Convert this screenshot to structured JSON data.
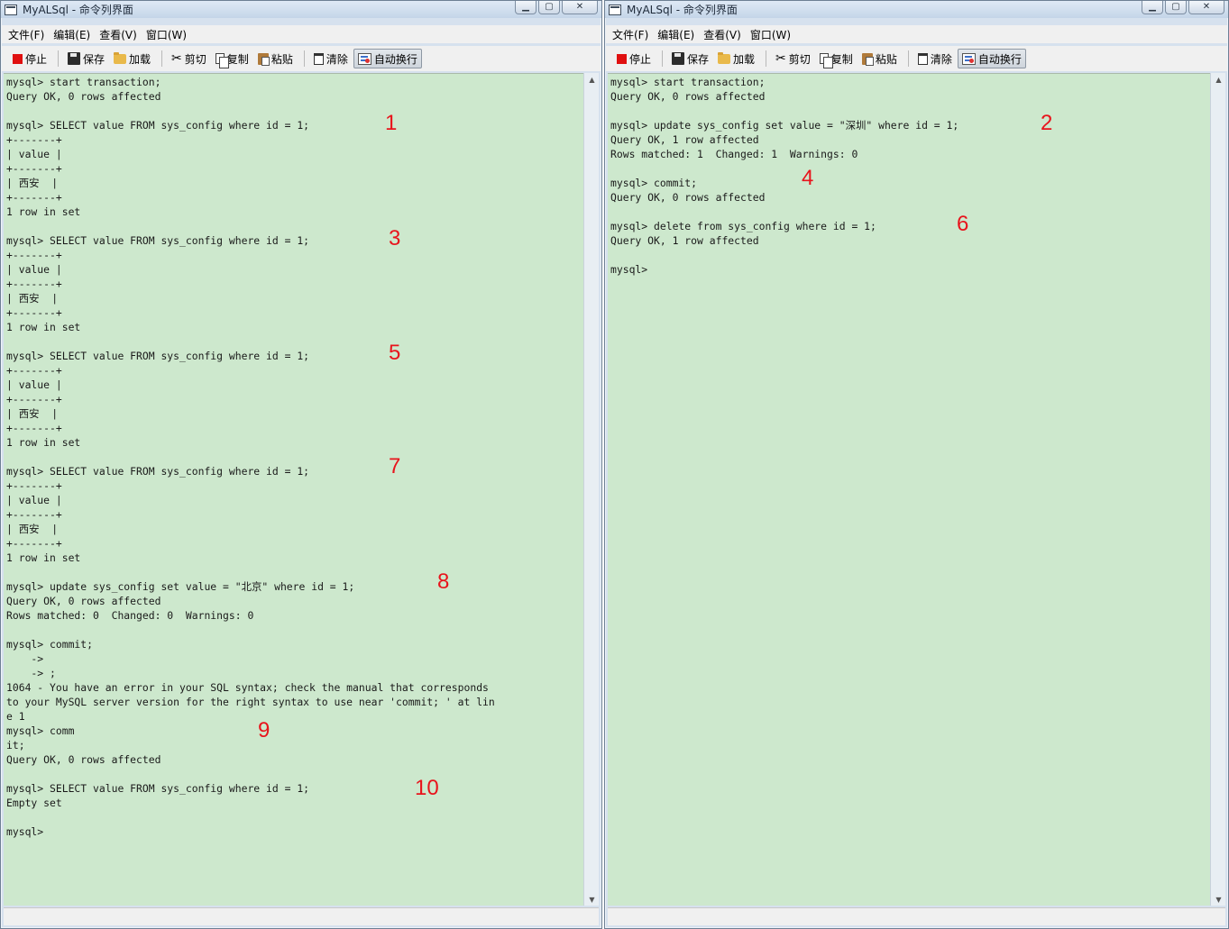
{
  "windows": {
    "left": {
      "title": "MyALSql - 命令列界面",
      "lines": [
        "mysql> start transaction;",
        "Query OK, 0 rows affected",
        "",
        "mysql> SELECT value FROM sys_config where id = 1;",
        "+-------+",
        "| value |",
        "+-------+",
        "| 西安  |",
        "+-------+",
        "1 row in set",
        "",
        "mysql> SELECT value FROM sys_config where id = 1;",
        "+-------+",
        "| value |",
        "+-------+",
        "| 西安  |",
        "+-------+",
        "1 row in set",
        "",
        "mysql> SELECT value FROM sys_config where id = 1;",
        "+-------+",
        "| value |",
        "+-------+",
        "| 西安  |",
        "+-------+",
        "1 row in set",
        "",
        "mysql> SELECT value FROM sys_config where id = 1;",
        "+-------+",
        "| value |",
        "+-------+",
        "| 西安  |",
        "+-------+",
        "1 row in set",
        "",
        "mysql> update sys_config set value = \"北京\" where id = 1;",
        "Query OK, 0 rows affected",
        "Rows matched: 0  Changed: 0  Warnings: 0",
        "",
        "mysql> commit;",
        "    ->",
        "    -> ;",
        "1064 - You have an error in your SQL syntax; check the manual that corresponds",
        "to your MySQL server version for the right syntax to use near 'commit; ' at lin",
        "e 1",
        "mysql> comm",
        "it;",
        "Query OK, 0 rows affected",
        "",
        "mysql> SELECT value FROM sys_config where id = 1;",
        "Empty set",
        "",
        "mysql>"
      ],
      "annotations": [
        "1",
        "3",
        "5",
        "7",
        "8",
        "9",
        "10"
      ]
    },
    "right": {
      "title": "MyALSql - 命令列界面",
      "lines": [
        "mysql> start transaction;",
        "Query OK, 0 rows affected",
        "",
        "mysql> update sys_config set value = \"深圳\" where id = 1;",
        "Query OK, 1 row affected",
        "Rows matched: 1  Changed: 1  Warnings: 0",
        "",
        "mysql> commit;",
        "Query OK, 0 rows affected",
        "",
        "mysql> delete from sys_config where id = 1;",
        "Query OK, 1 row affected",
        "",
        "mysql>"
      ],
      "annotations": [
        "2",
        "4",
        "6"
      ]
    }
  },
  "menu": [
    "文件(F)",
    "编辑(E)",
    "查看(V)",
    "窗口(W)"
  ],
  "toolbar": {
    "stop": "停止",
    "save": "保存",
    "load": "加载",
    "cut": "剪切",
    "copy": "复制",
    "paste": "粘贴",
    "clear": "清除",
    "wrap": "自动换行"
  },
  "colors": {
    "console_bg": "#cde8cd",
    "annotation": "#e8141c",
    "stop_icon": "#e01010"
  }
}
